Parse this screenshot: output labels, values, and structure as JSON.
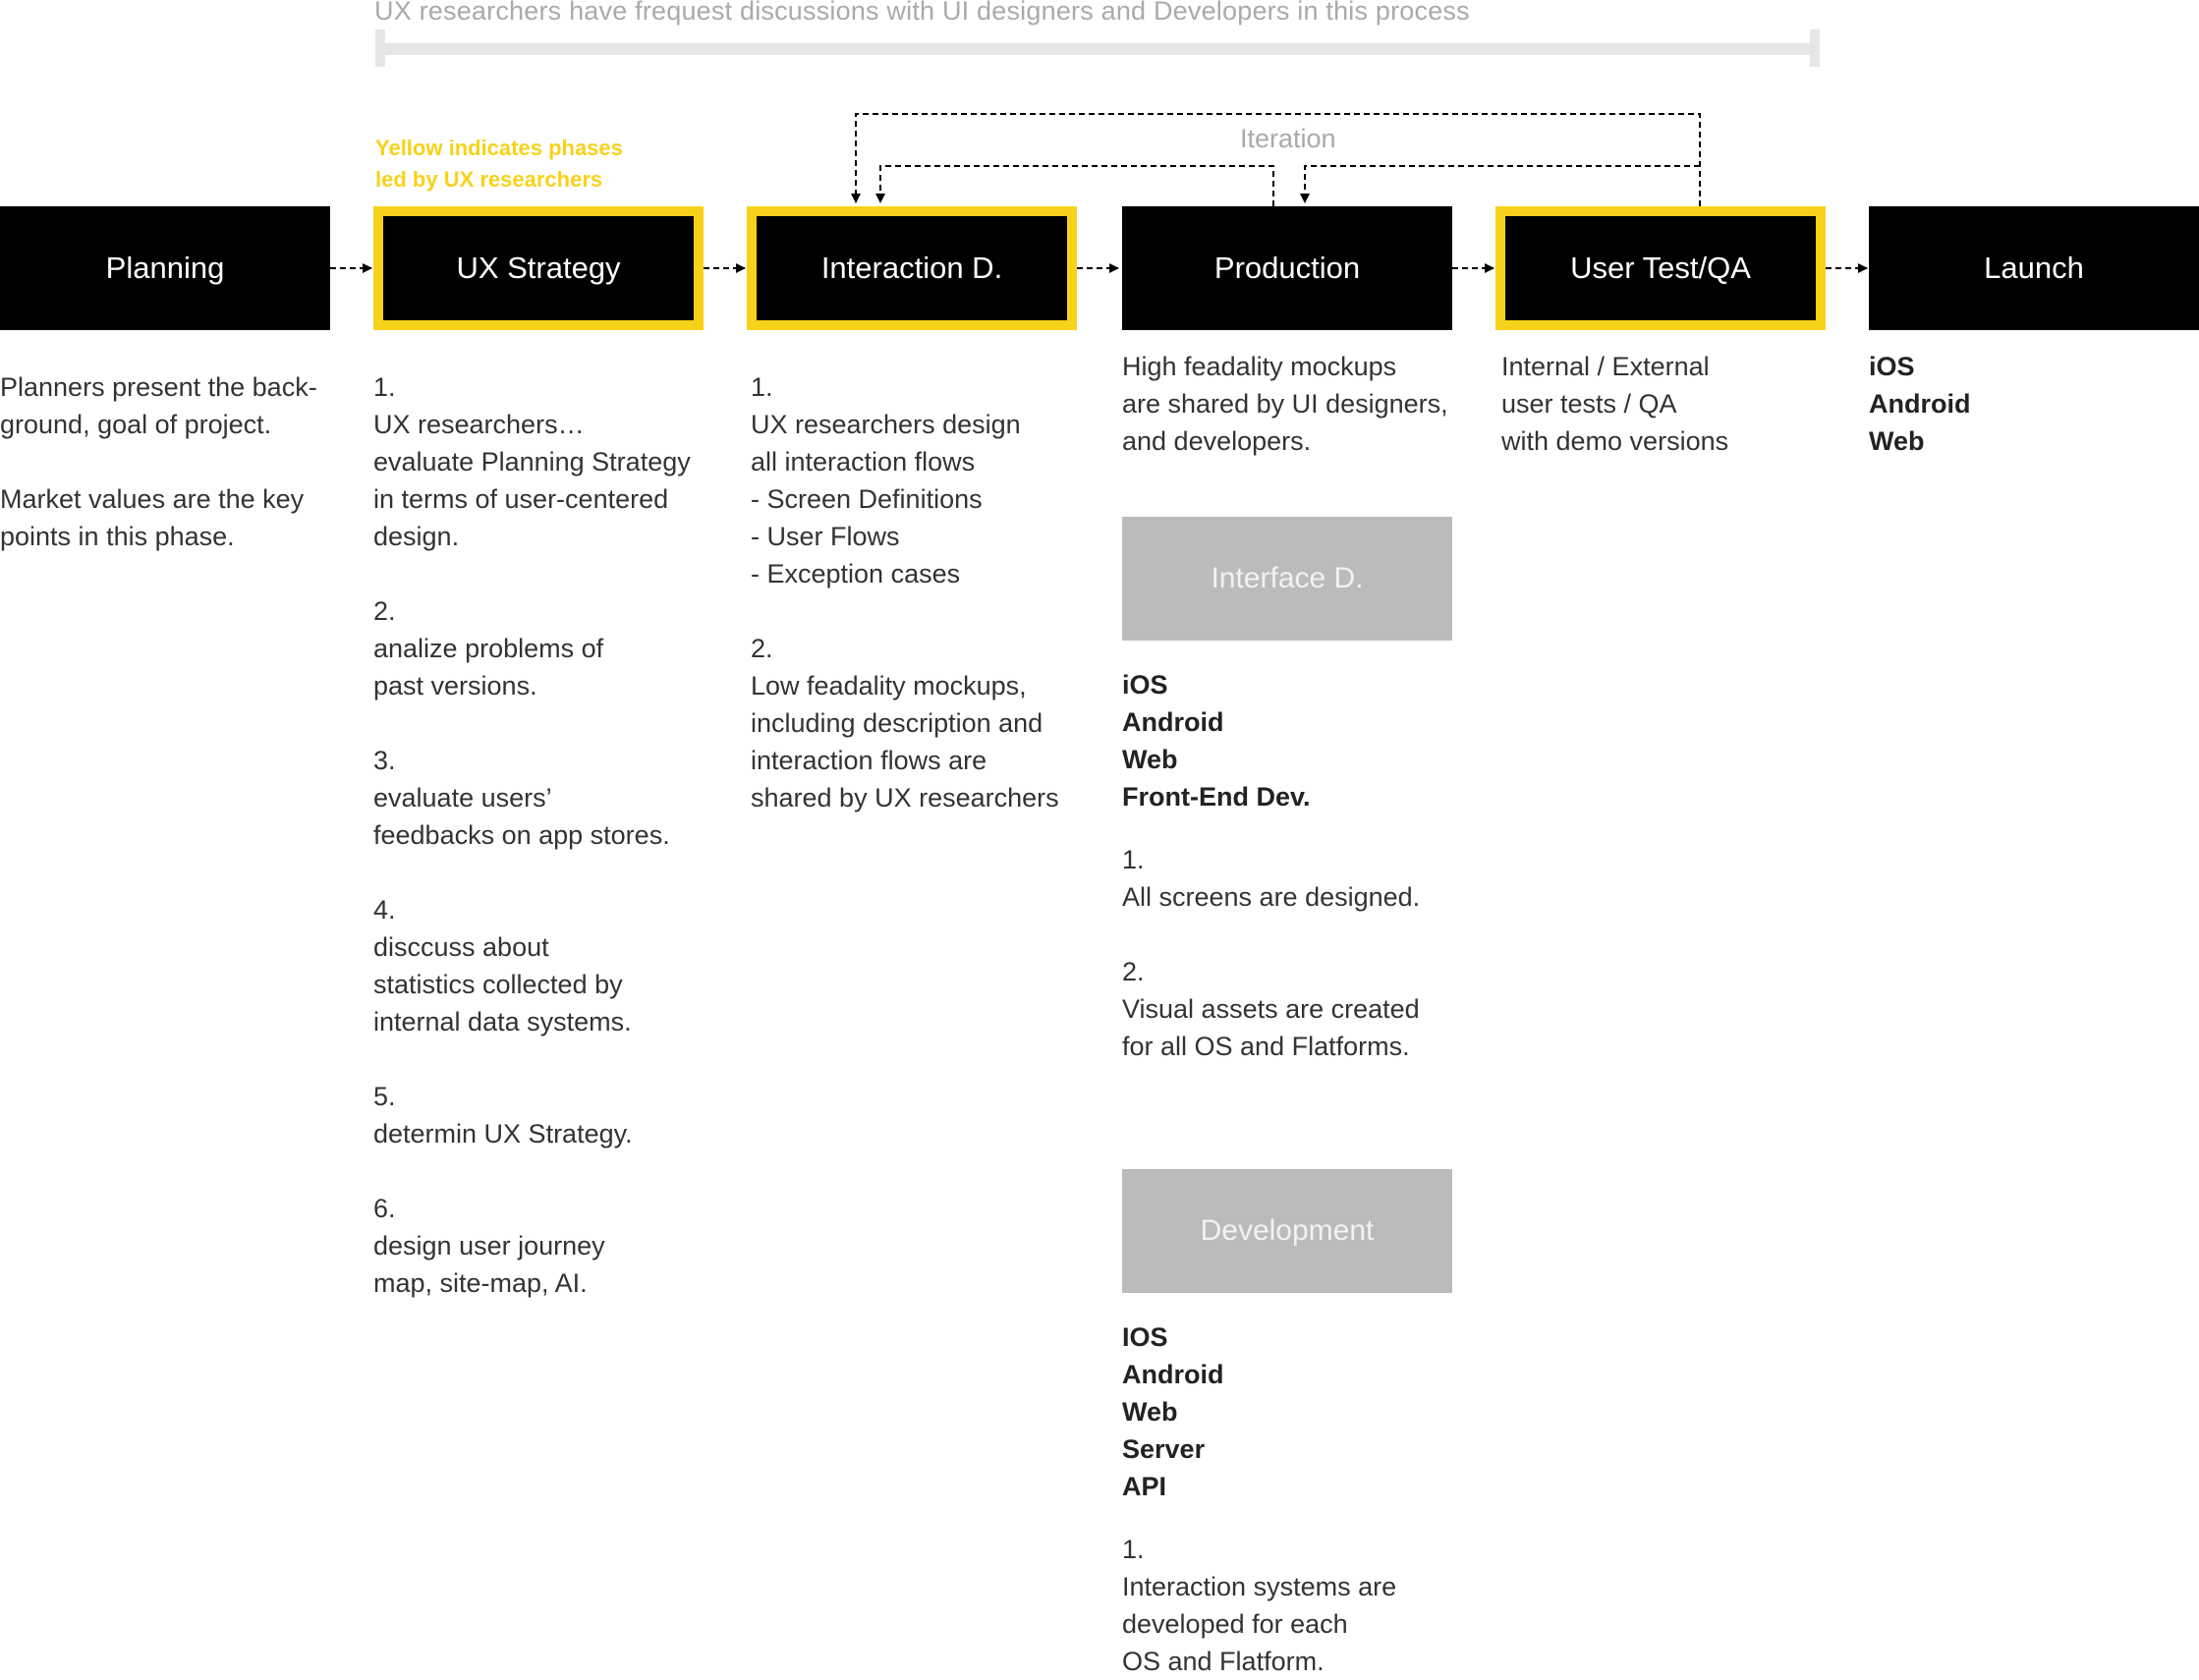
{
  "top_note": "UX researchers have frequest discussions with UI designers and Developers in this process",
  "legend": [
    "Yellow indicates phases",
    "led by UX researchers"
  ],
  "iteration_label": "Iteration",
  "colors": {
    "ux_highlight": "#f7d21a",
    "phase_bg": "#000000",
    "sub_phase_bg": "#bbbbbb"
  },
  "phases": [
    {
      "label": "Planning",
      "ux_led": false
    },
    {
      "label": "UX Strategy",
      "ux_led": true
    },
    {
      "label": "Interaction D.",
      "ux_led": true
    },
    {
      "label": "Production",
      "ux_led": false
    },
    {
      "label": "User Test/QA",
      "ux_led": true
    },
    {
      "label": "Launch",
      "ux_led": false
    }
  ],
  "planning": {
    "p1": "Planners present the back-\nground, goal of project.",
    "p2": "Market values are the key\npoints in this phase."
  },
  "ux_strategy": {
    "s1": "1.\nUX researchers…\nevaluate Planning Strategy\nin terms of user-centered\ndesign.",
    "s2": "2.\nanalize problems of\npast versions.",
    "s3": "3.\nevaluate users’\nfeedbacks on app stores.",
    "s4": "4.\ndisccuss about\nstatistics collected by\ninternal data systems.",
    "s5": "5.\ndetermin UX Strategy.",
    "s6": "6.\ndesign user journey\nmap, site-map, AI."
  },
  "interaction": {
    "s1": "1.\nUX researchers design\nall interaction flows\n- Screen Definitions\n- User Flows\n- Exception cases",
    "s2": "2.\nLow feadality mockups,\nincluding description and\ninteraction flows are\nshared by UX researchers"
  },
  "production": {
    "intro": "High feadality mockups\nare shared by UI designers,\nand developers.",
    "interface": {
      "label": "Interface D.",
      "platforms": [
        "iOS",
        "Android",
        "Web",
        "Front-End Dev."
      ],
      "s1": "1.\nAll screens are designed.",
      "s2": "2.\nVisual assets are created\nfor all OS and Flatforms."
    },
    "development": {
      "label": "Development",
      "platforms": [
        "IOS",
        "Android",
        "Web",
        "Server",
        "API"
      ],
      "s1": "1.\nInteraction systems are\ndeveloped for each\nOS and Flatform."
    }
  },
  "user_test": {
    "text": "Internal / External\nuser tests / QA\nwith demo versions"
  },
  "launch": {
    "platforms": [
      "iOS",
      "Android",
      "Web"
    ]
  }
}
